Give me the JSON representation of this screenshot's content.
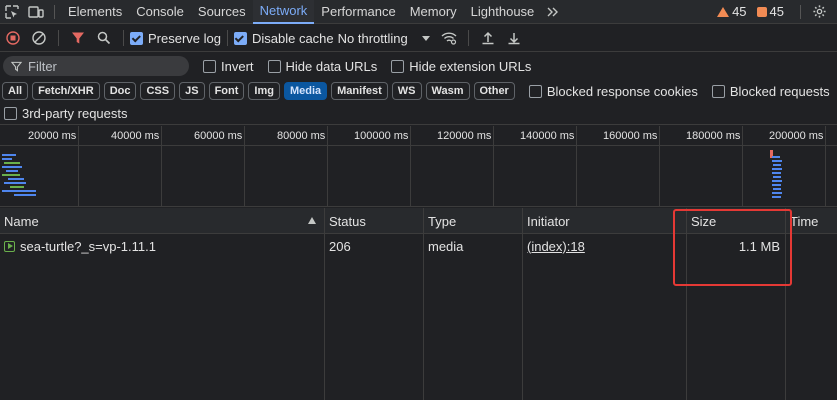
{
  "tabs": [
    "Elements",
    "Console",
    "Sources",
    "Network",
    "Performance",
    "Memory",
    "Lighthouse"
  ],
  "active_tab": "Network",
  "warnings_count": "45",
  "errors_count": "45",
  "toolbar": {
    "preserve_log_label": "Preserve log",
    "disable_cache_label": "Disable cache",
    "throttling_value": "No throttling"
  },
  "filter": {
    "placeholder": "Filter",
    "invert_label": "Invert",
    "hide_data_urls_label": "Hide data URLs",
    "hide_extension_urls_label": "Hide extension URLs"
  },
  "type_filters": [
    "All",
    "Fetch/XHR",
    "Doc",
    "CSS",
    "JS",
    "Font",
    "Img",
    "Media",
    "Manifest",
    "WS",
    "Wasm",
    "Other"
  ],
  "active_type_filter": "Media",
  "blocked_response_cookies_label": "Blocked response cookies",
  "blocked_requests_label": "Blocked requests",
  "third_party_label": "3rd-party requests",
  "overview_ticks": [
    "20000 ms",
    "40000 ms",
    "60000 ms",
    "80000 ms",
    "100000 ms",
    "120000 ms",
    "140000 ms",
    "160000 ms",
    "180000 ms",
    "200000 ms"
  ],
  "columns": [
    "Name",
    "Status",
    "Type",
    "Initiator",
    "Size",
    "Time"
  ],
  "requests": [
    {
      "name": "sea-turtle?_s=vp-1.11.1",
      "status": "206",
      "type": "media",
      "initiator": "(index):18",
      "size": "1.1 MB",
      "time": ""
    }
  ],
  "colors": {
    "accent": "#7cacf8",
    "highlight": "#e53935",
    "active_pill": "#0b57a0"
  }
}
